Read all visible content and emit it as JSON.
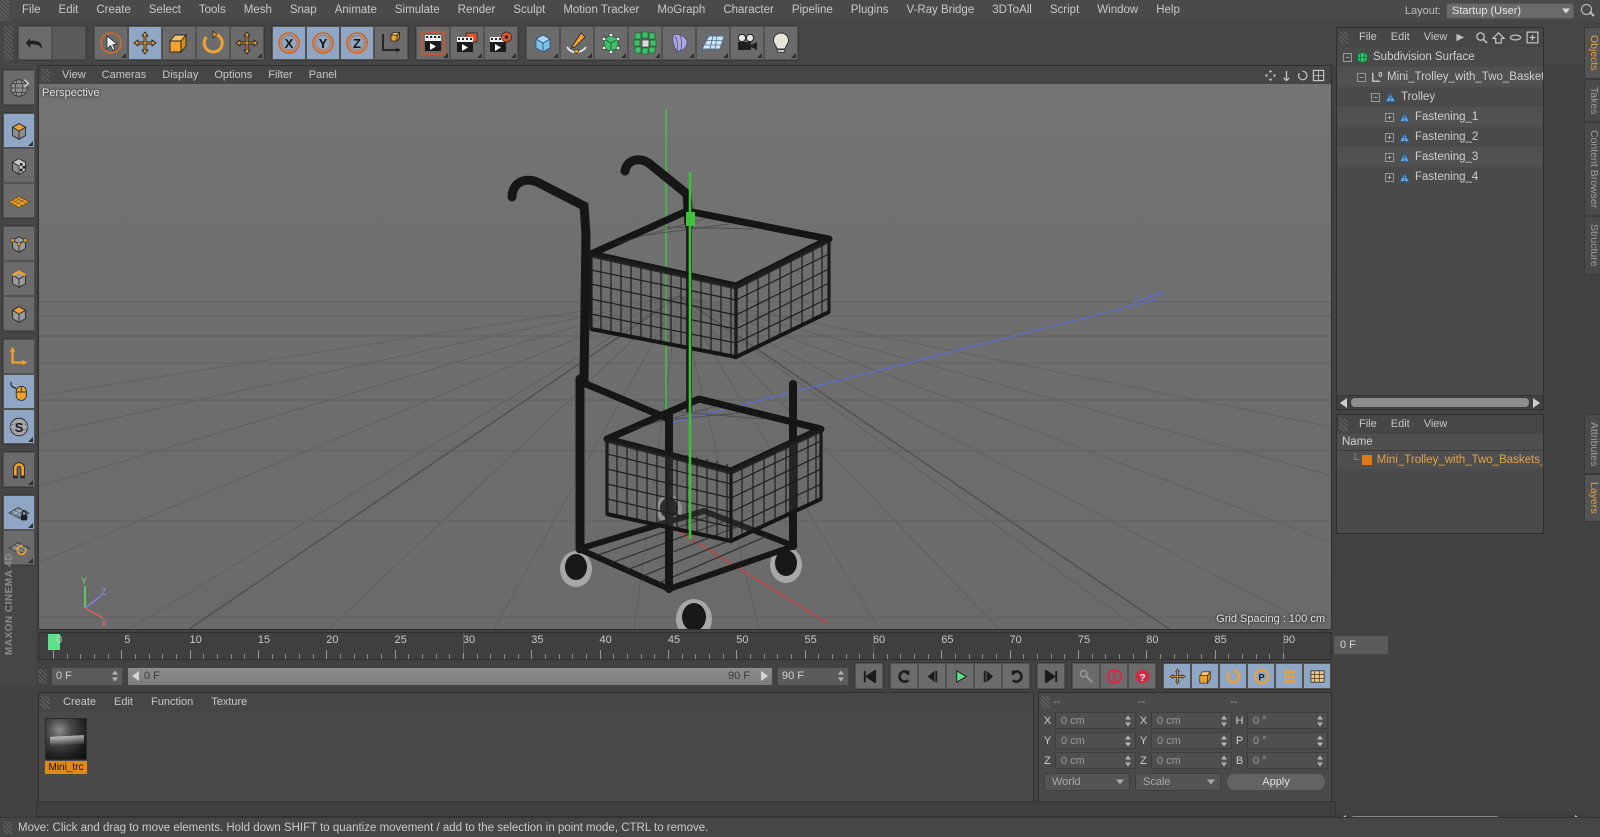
{
  "app": {
    "title": "MAXON CINEMA 4D",
    "brand": "MAXON CINEMA 4D"
  },
  "menubar": {
    "items": [
      {
        "label": "File"
      },
      {
        "label": "Edit"
      },
      {
        "label": "Create"
      },
      {
        "label": "Select"
      },
      {
        "label": "Tools"
      },
      {
        "label": "Mesh"
      },
      {
        "label": "Snap"
      },
      {
        "label": "Animate"
      },
      {
        "label": "Simulate"
      },
      {
        "label": "Render"
      },
      {
        "label": "Sculpt"
      },
      {
        "label": "Motion Tracker"
      },
      {
        "label": "MoGraph"
      },
      {
        "label": "Character"
      },
      {
        "label": "Pipeline"
      },
      {
        "label": "Plugins"
      },
      {
        "label": "V-Ray Bridge"
      },
      {
        "label": "3DToAll"
      },
      {
        "label": "Script"
      },
      {
        "label": "Window"
      },
      {
        "label": "Help"
      }
    ],
    "layout_label": "Layout:",
    "layout_value": "Startup (User)",
    "search_icon": "magnifier-icon"
  },
  "toolbar": {
    "groups": [
      {
        "name": "history",
        "buttons": [
          {
            "name": "undo-button",
            "icon": "undo-icon",
            "state": "normal"
          },
          {
            "name": "redo-button",
            "icon": "redo-icon",
            "state": "disabled"
          }
        ]
      },
      {
        "name": "transform",
        "buttons": [
          {
            "name": "select-tool",
            "icon": "cursor-select-icon",
            "state": "normal"
          },
          {
            "name": "move-tool",
            "icon": "move-icon",
            "state": "active"
          },
          {
            "name": "scale-tool",
            "icon": "scale-icon",
            "state": "normal"
          },
          {
            "name": "rotate-tool",
            "icon": "rotate-icon",
            "state": "normal"
          },
          {
            "name": "move-axis-tool",
            "icon": "move-axis-icon",
            "state": "normal"
          }
        ]
      },
      {
        "name": "axis-lock",
        "buttons": [
          {
            "name": "lock-x-axis",
            "icon": "axis-x-icon",
            "state": "active",
            "label": "X"
          },
          {
            "name": "lock-y-axis",
            "icon": "axis-y-icon",
            "state": "active",
            "label": "Y"
          },
          {
            "name": "lock-z-axis",
            "icon": "axis-z-icon",
            "state": "active",
            "label": "Z"
          },
          {
            "name": "world-coordinate-toggle",
            "icon": "world-axis-icon",
            "state": "normal"
          }
        ]
      },
      {
        "name": "render",
        "buttons": [
          {
            "name": "render-view-button",
            "icon": "render-view-icon",
            "state": "normal"
          },
          {
            "name": "render-to-picture-viewer",
            "icon": "render-picture-icon",
            "state": "normal"
          },
          {
            "name": "render-settings-button",
            "icon": "render-settings-icon",
            "state": "normal"
          }
        ]
      },
      {
        "name": "create",
        "buttons": [
          {
            "name": "add-cube-primitive",
            "icon": "cube-icon",
            "state": "normal"
          },
          {
            "name": "add-spline",
            "icon": "pen-spline-icon",
            "state": "normal"
          },
          {
            "name": "add-generator",
            "icon": "generator-icon",
            "state": "normal"
          },
          {
            "name": "add-mograph",
            "icon": "mograph-icon",
            "state": "normal"
          },
          {
            "name": "add-deformer",
            "icon": "deformer-icon",
            "state": "normal"
          },
          {
            "name": "add-scene-object",
            "icon": "floor-scene-icon",
            "state": "normal"
          },
          {
            "name": "add-camera",
            "icon": "camera-icon",
            "state": "normal"
          },
          {
            "name": "add-light",
            "icon": "light-bulb-icon",
            "state": "normal"
          }
        ]
      }
    ]
  },
  "left_toolbar": {
    "buttons": [
      {
        "name": "undo-view-button",
        "icon": "globe-wire-icon",
        "state": "normal"
      },
      {
        "name": "model-mode",
        "icon": "model-cube-icon",
        "state": "active"
      },
      {
        "name": "texture-mode",
        "icon": "texture-cube-icon",
        "state": "normal"
      },
      {
        "name": "uv-mesh-mode",
        "icon": "uv-mesh-icon",
        "state": "normal"
      },
      {
        "name": "point-mode",
        "icon": "points-cube-icon",
        "state": "normal"
      },
      {
        "name": "edge-mode",
        "icon": "edge-cube-icon",
        "state": "normal"
      },
      {
        "name": "polygon-mode",
        "icon": "polygon-cube-icon",
        "state": "normal"
      },
      {
        "name": "axis-mode",
        "icon": "axis-l-icon",
        "state": "normal"
      },
      {
        "name": "viewport-solo-mode",
        "icon": "mouse-icon",
        "state": "active"
      },
      {
        "name": "enable-snapping",
        "icon": "snap-s-icon",
        "state": "active"
      },
      {
        "name": "magnet-tool",
        "icon": "magnet-icon",
        "state": "normal"
      },
      {
        "name": "lock-workplane",
        "icon": "workplane-lock-icon",
        "state": "active"
      },
      {
        "name": "planar-workplane",
        "icon": "workplane-rotate-icon",
        "state": "normal"
      }
    ]
  },
  "viewport": {
    "menu": [
      {
        "label": "View"
      },
      {
        "label": "Cameras"
      },
      {
        "label": "Display"
      },
      {
        "label": "Options"
      },
      {
        "label": "Filter"
      },
      {
        "label": "Panel"
      }
    ],
    "label": "Perspective",
    "grid_spacing": "Grid Spacing : 100 cm",
    "axis_gizmo": {
      "y": "Y",
      "z": "Z",
      "x": "X"
    },
    "icons": [
      "pan-icon",
      "zoom-icon",
      "rotate-view-icon",
      "maximize-icon"
    ],
    "scene_object": "Mini trolley with two baskets (black wire cart)"
  },
  "timeline": {
    "start": 0,
    "end": 90,
    "tick_labels": [
      0,
      5,
      10,
      15,
      20,
      25,
      30,
      35,
      40,
      45,
      50,
      55,
      60,
      65,
      70,
      75,
      80,
      85,
      90
    ],
    "current_frame_field": "0 F",
    "playhead_frame": 0
  },
  "animbar": {
    "current_frame": "0 F",
    "scrub_start": "0 F",
    "scrub_end": "90 F",
    "end_frame": "90 F",
    "transport": [
      {
        "name": "go-to-start-button",
        "icon": "skip-back-icon"
      },
      {
        "name": "rewind-button",
        "icon": "rewind-loop-icon"
      },
      {
        "name": "step-back-button",
        "icon": "step-back-icon"
      },
      {
        "name": "play-button",
        "icon": "play-icon"
      },
      {
        "name": "step-forward-button",
        "icon": "step-forward-icon"
      },
      {
        "name": "forward-loop-button",
        "icon": "forward-loop-icon"
      },
      {
        "name": "go-to-end-button",
        "icon": "skip-forward-icon"
      }
    ],
    "record_group": [
      {
        "name": "autokey-toggle",
        "icon": "key-icon"
      },
      {
        "name": "record-active-objects",
        "icon": "record-circle-icon"
      },
      {
        "name": "record-question-button",
        "icon": "record-question-icon"
      }
    ],
    "key_group": [
      {
        "name": "key-position-toggle",
        "icon": "key-position-icon"
      },
      {
        "name": "key-scale-toggle",
        "icon": "key-scale-icon"
      },
      {
        "name": "key-rotation-toggle",
        "icon": "key-rotation-icon"
      },
      {
        "name": "key-parameter-toggle",
        "icon": "key-parameter-icon"
      },
      {
        "name": "key-pla-toggle",
        "icon": "key-pla-icon"
      },
      {
        "name": "timeline-toggle",
        "icon": "timeline-icon"
      }
    ]
  },
  "material_manager": {
    "menu": [
      {
        "label": "Create"
      },
      {
        "label": "Edit"
      },
      {
        "label": "Function"
      },
      {
        "label": "Texture"
      }
    ],
    "materials": [
      {
        "name": "Mini_trc",
        "icon": "material-sphere-icon"
      }
    ]
  },
  "coordinates": {
    "headers": [
      "--",
      "--",
      "--"
    ],
    "rows": [
      {
        "pos_label": "X",
        "pos_value": "0 cm",
        "size_label": "X",
        "size_value": "0 cm",
        "rot_label": "H",
        "rot_value": "0 °"
      },
      {
        "pos_label": "Y",
        "pos_value": "0 cm",
        "size_label": "Y",
        "size_value": "0 cm",
        "rot_label": "P",
        "rot_value": "0 °"
      },
      {
        "pos_label": "Z",
        "pos_value": "0 cm",
        "size_label": "Z",
        "size_value": "0 cm",
        "rot_label": "B",
        "rot_value": "0 °"
      }
    ],
    "system_select": "World",
    "mode_select": "Scale",
    "apply_label": "Apply"
  },
  "object_manager": {
    "menu": [
      {
        "label": "File"
      },
      {
        "label": "Edit"
      },
      {
        "label": "View"
      }
    ],
    "menu_more": "chevron-right-icon",
    "icons": [
      "search-icon",
      "home-icon",
      "ellipse-icon",
      "new-layer-icon"
    ],
    "tree": [
      {
        "label": "Subdivision Surface",
        "depth": 0,
        "icon": "subdivision-surface-icon",
        "expander": "minus"
      },
      {
        "label": "Mini_Trolley_with_Two_Baskets_I",
        "depth": 1,
        "icon": "null-object-icon",
        "expander": "minus"
      },
      {
        "label": "Trolley",
        "depth": 2,
        "icon": "polygon-object-icon",
        "expander": "minus"
      },
      {
        "label": "Fastening_1",
        "depth": 3,
        "icon": "polygon-object-icon",
        "expander": "plus"
      },
      {
        "label": "Fastening_2",
        "depth": 3,
        "icon": "polygon-object-icon",
        "expander": "plus"
      },
      {
        "label": "Fastening_3",
        "depth": 3,
        "icon": "polygon-object-icon",
        "expander": "plus"
      },
      {
        "label": "Fastening_4",
        "depth": 3,
        "icon": "polygon-object-icon",
        "expander": "plus"
      }
    ]
  },
  "layer_manager": {
    "menu": [
      {
        "label": "File"
      },
      {
        "label": "Edit"
      },
      {
        "label": "View"
      }
    ],
    "column_header": "Name",
    "rows": [
      {
        "name": "Mini_Trolley_with_Two_Baskets_Bl",
        "color": "#e07a18"
      }
    ]
  },
  "vertical_tabs_top": [
    {
      "label": "Objects",
      "active": true
    },
    {
      "label": "Takes",
      "active": false
    },
    {
      "label": "Content Browser",
      "active": false
    },
    {
      "label": "Structure",
      "active": false
    }
  ],
  "vertical_tabs_bottom": [
    {
      "label": "Attributes",
      "active": false
    },
    {
      "label": "Layers",
      "active": true
    }
  ],
  "statusbar": {
    "text": "Move: Click and drag to move elements. Hold down SHIFT to quantize movement / add to the selection in point mode, CTRL to remove."
  },
  "colors": {
    "accent_orange": "#e5a24a",
    "active_blue": "#8fa7c4",
    "panel_bg": "#4a4a4a",
    "toolbar_bg": "#464646",
    "viewport_bg": "#6e6e6e",
    "axis_green": "#3ec23e",
    "axis_red": "#d44a4a",
    "axis_blue": "#4a6fd4",
    "playhead_green": "#5fe08a"
  }
}
